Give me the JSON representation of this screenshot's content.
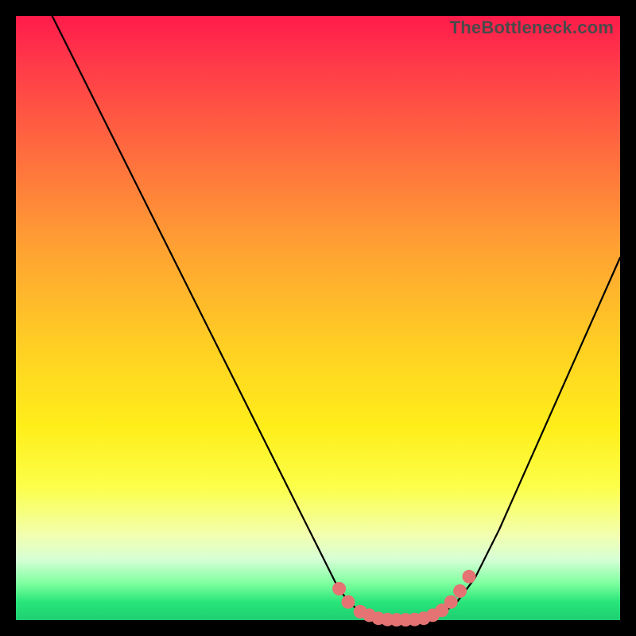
{
  "watermark": "TheBottleneck.com",
  "colors": {
    "curve_stroke": "#000000",
    "marker_fill": "#e57373",
    "marker_stroke": "#c75b5b"
  },
  "chart_data": {
    "type": "line",
    "title": "",
    "xlabel": "",
    "ylabel": "",
    "xlim": [
      0,
      100
    ],
    "ylim": [
      0,
      100
    ],
    "series": [
      {
        "name": "bottleneck-curve",
        "x": [
          6,
          10,
          14,
          18,
          22,
          26,
          30,
          34,
          38,
          42,
          46,
          50,
          53,
          55,
          57,
          59,
          61,
          63,
          65,
          67,
          69,
          71,
          73,
          76,
          80,
          84,
          88,
          92,
          96,
          100
        ],
        "y": [
          100,
          92,
          84,
          76,
          68,
          60,
          52,
          44,
          36,
          28,
          20,
          12,
          6,
          3,
          1.4,
          0.6,
          0.2,
          0.05,
          0.05,
          0.2,
          0.6,
          1.4,
          3,
          7,
          15,
          24,
          33,
          42,
          51,
          60
        ]
      }
    ],
    "markers": {
      "name": "highlighted-range",
      "x": [
        53.5,
        55,
        57,
        58.5,
        60,
        61.5,
        63,
        64.5,
        66,
        67.5,
        69,
        70.5,
        72,
        73.5,
        75
      ],
      "y": [
        5.2,
        3.0,
        1.4,
        0.8,
        0.3,
        0.1,
        0.05,
        0.05,
        0.1,
        0.3,
        0.8,
        1.6,
        3.0,
        4.8,
        7.2
      ]
    }
  }
}
